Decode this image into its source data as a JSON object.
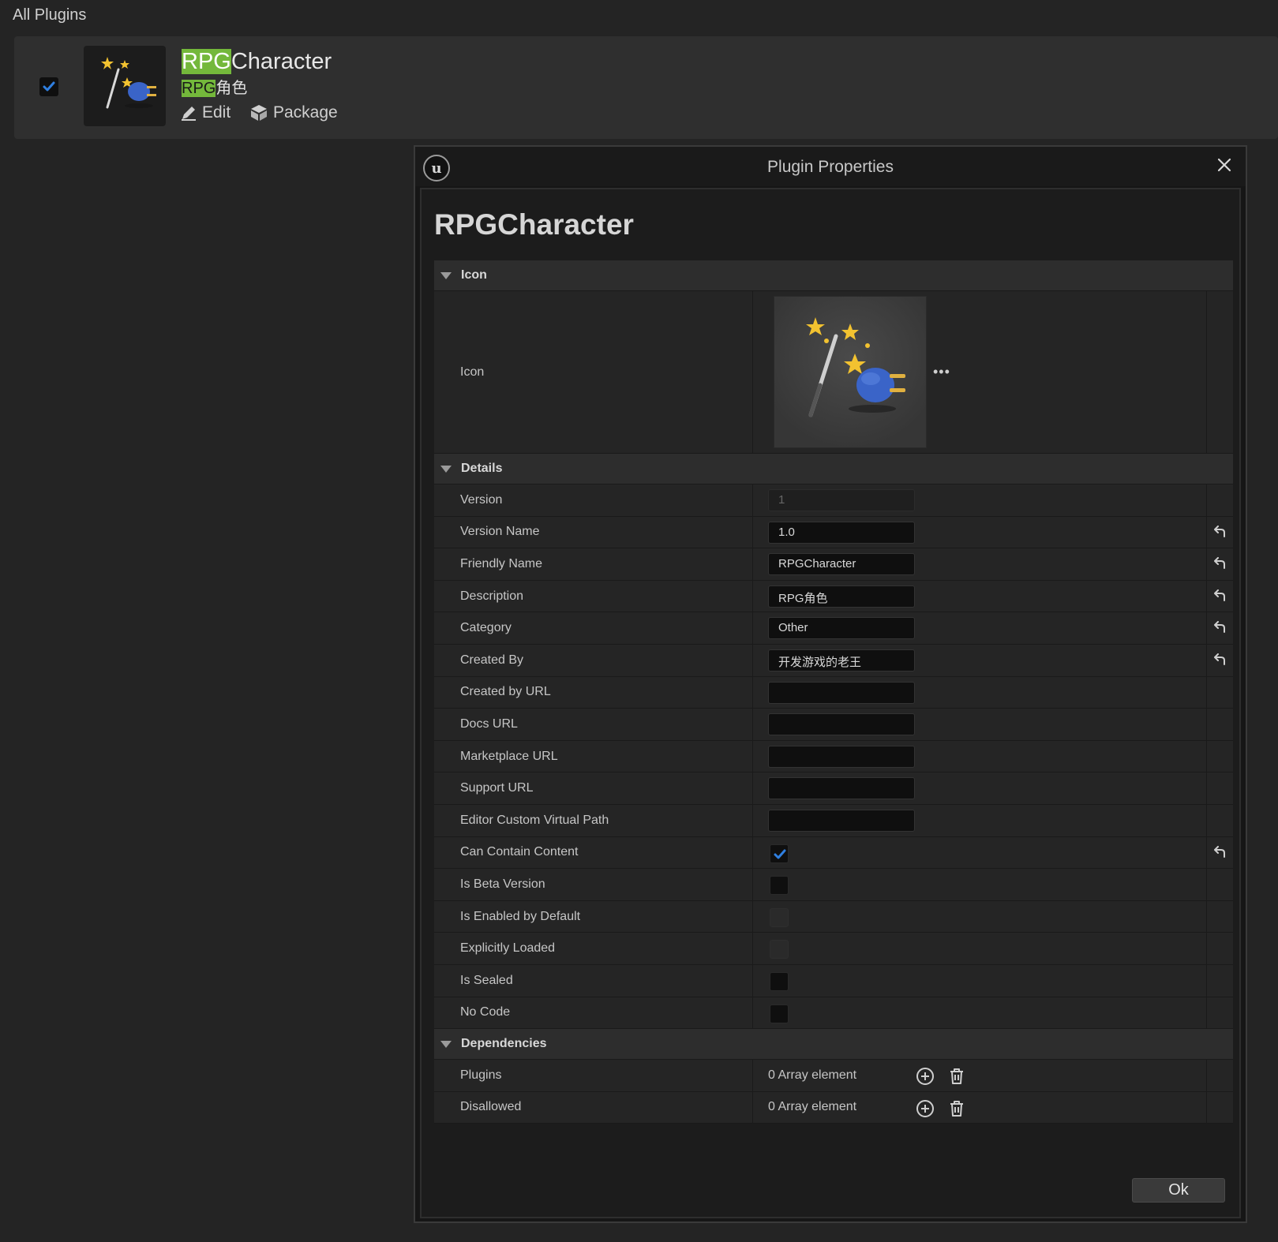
{
  "header": {
    "title": "All Plugins"
  },
  "plugin_card": {
    "checked": true,
    "title_highlight": "RPG",
    "title_rest": "Character",
    "subtitle_highlight": "RPG",
    "subtitle_rest": "角色",
    "edit_label": "Edit",
    "package_label": "Package",
    "icon": "magic-wand-plug-icon"
  },
  "dialog": {
    "title": "Plugin Properties",
    "plugin_name": "RPGCharacter",
    "ok_label": "Ok",
    "sections": {
      "icon": {
        "header": "Icon",
        "row_label": "Icon",
        "more": "•••"
      },
      "details": {
        "header": "Details",
        "version": {
          "label": "Version",
          "value": "1"
        },
        "version_name": {
          "label": "Version Name",
          "value": "1.0"
        },
        "friendly_name": {
          "label": "Friendly Name",
          "value": "RPGCharacter"
        },
        "description": {
          "label": "Description",
          "value": "RPG角色"
        },
        "category": {
          "label": "Category",
          "value": "Other"
        },
        "created_by": {
          "label": "Created By",
          "value": "开发游戏的老王"
        },
        "created_by_url": {
          "label": "Created by URL",
          "value": ""
        },
        "docs_url": {
          "label": "Docs URL",
          "value": ""
        },
        "marketplace_url": {
          "label": "Marketplace URL",
          "value": ""
        },
        "support_url": {
          "label": "Support URL",
          "value": ""
        },
        "editor_custom_virtual_path": {
          "label": "Editor Custom Virtual Path",
          "value": ""
        },
        "can_contain_content": {
          "label": "Can Contain Content",
          "checked": true
        },
        "is_beta_version": {
          "label": "Is Beta Version",
          "checked": false
        },
        "is_enabled_by_default": {
          "label": "Is Enabled by Default",
          "checked": false
        },
        "explicitly_loaded": {
          "label": "Explicitly Loaded",
          "checked": false
        },
        "is_sealed": {
          "label": "Is Sealed",
          "checked": false
        },
        "no_code": {
          "label": "No Code",
          "checked": false
        }
      },
      "dependencies": {
        "header": "Dependencies",
        "plugins": {
          "label": "Plugins",
          "value": "0 Array element"
        },
        "disallowed": {
          "label": "Disallowed",
          "value": "0 Array element"
        }
      }
    }
  },
  "colors": {
    "background": "#242424",
    "highlight": "#74b83b",
    "checkbox_check": "#2f7fe0"
  }
}
